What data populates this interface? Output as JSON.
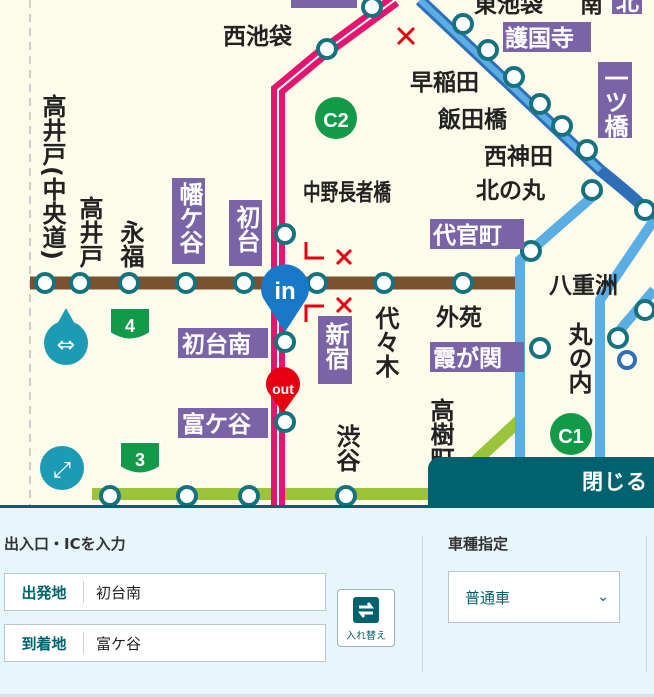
{
  "map": {
    "stations": {
      "nishi_ikebukuro": "西池袋",
      "gokokuji": "護国寺",
      "waseda": "早稲田",
      "iidabashi": "飯田橋",
      "hitotsubashi": "一ツ橋",
      "nishi_kanda": "西神田",
      "kitanomaru": "北の丸",
      "daikancho": "代官町",
      "takaido_chuodo": "高井戸(中央道)",
      "takaido": "高井戸",
      "eifuku": "永福",
      "hatagaya": "幡ケ谷",
      "hatsudai": "初台",
      "nakano_chojabashi": "中野長者橋",
      "yaesu": "八重洲",
      "gaien": "外苑",
      "yoyogi": "代々木",
      "shinjuku": "新宿",
      "hatsudai_minami": "初台南",
      "kasumigaseki": "霞が関",
      "marunouchi": "丸の内",
      "tomigaya": "富ケ谷",
      "shibuya": "渋谷",
      "takagi": "高樹町",
      "higashi_ikebukuro": "東池袋",
      "minami": "南",
      "kita": "北",
      "top_cut": "高"
    },
    "route_badges": {
      "c2": "C2",
      "c1": "C1",
      "r4": "4",
      "r3": "3"
    },
    "markers": {
      "in": "in",
      "out": "out"
    }
  },
  "close_button": "閉じる",
  "panel": {
    "entry_title": "出入口・ICを入力",
    "departure_label": "出発地",
    "departure_value": "初台南",
    "arrival_label": "到着地",
    "arrival_value": "富ケ谷",
    "swap_label": "入れ替え",
    "vehicle_title": "車種指定",
    "vehicle_value": "普通車"
  },
  "colors": {
    "c2_line": "#e4146f",
    "route4_line": "#7a5230",
    "c1_line": "#5aaee3",
    "route3_line": "#99c43b",
    "accent": "#00626e",
    "label_bg": "#7b63a7"
  }
}
